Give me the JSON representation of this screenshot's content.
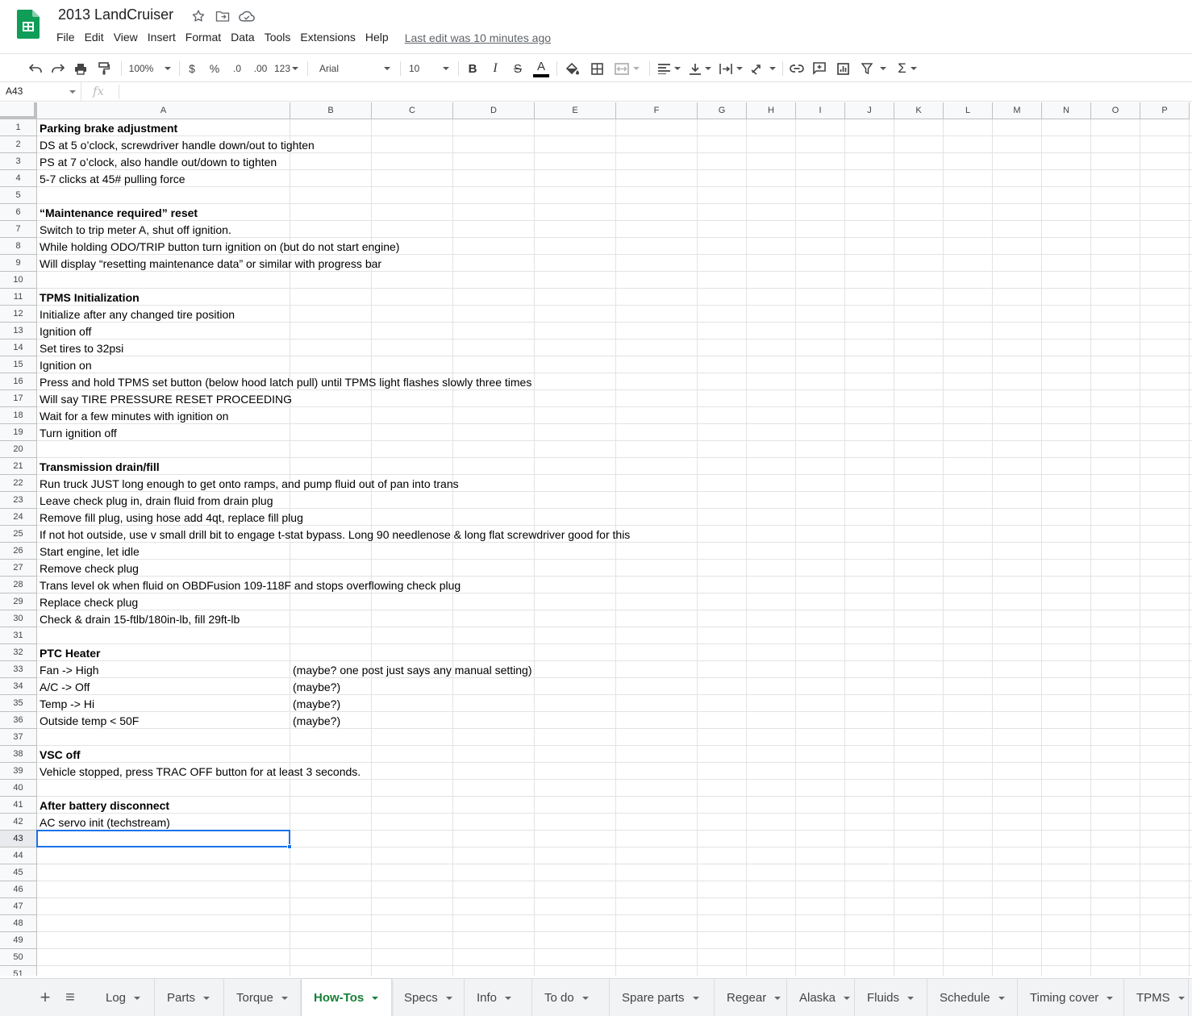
{
  "app": {
    "doc_title": "2013 LandCruiser",
    "last_edit": "Last edit was 10 minutes ago",
    "brand_color": "#0f9d58"
  },
  "menu": [
    "File",
    "Edit",
    "View",
    "Insert",
    "Format",
    "Data",
    "Tools",
    "Extensions",
    "Help"
  ],
  "toolbar": {
    "zoom": "100%",
    "currency": "$",
    "percent": "%",
    "decrease_decimal": ".0",
    "increase_decimal": ".00",
    "number_format": "123",
    "font": "Arial",
    "font_size": "10",
    "text_color": "#000000"
  },
  "formula_bar": {
    "cell_ref": "A43",
    "fx": "fx",
    "value": ""
  },
  "columns": [
    "A",
    "B",
    "C",
    "D",
    "E",
    "F",
    "G",
    "H",
    "I",
    "J",
    "K",
    "L",
    "M",
    "N",
    "O",
    "P"
  ],
  "rows": [
    "1",
    "2",
    "3",
    "4",
    "5",
    "6",
    "7",
    "8",
    "9",
    "10",
    "11",
    "12",
    "13",
    "14",
    "15",
    "16",
    "17",
    "18",
    "19",
    "20",
    "21",
    "22",
    "23",
    "24",
    "25",
    "26",
    "27",
    "28",
    "29",
    "30",
    "31",
    "32",
    "33",
    "34",
    "35",
    "36",
    "37",
    "38",
    "39",
    "40",
    "41",
    "42",
    "43",
    "44",
    "45",
    "46",
    "47",
    "48",
    "49",
    "50",
    "51"
  ],
  "cells": [
    {
      "row": 1,
      "col": "A",
      "text": "Parking brake adjustment",
      "bold": true
    },
    {
      "row": 2,
      "col": "A",
      "text": "DS at 5 o’clock, screwdriver handle down/out to tighten"
    },
    {
      "row": 3,
      "col": "A",
      "text": "PS at 7 o’clock, also handle out/down to tighten"
    },
    {
      "row": 4,
      "col": "A",
      "text": "5-7 clicks at 45# pulling force"
    },
    {
      "row": 6,
      "col": "A",
      "text": "“Maintenance required” reset",
      "bold": true
    },
    {
      "row": 7,
      "col": "A",
      "text": "Switch to trip meter A, shut off ignition."
    },
    {
      "row": 8,
      "col": "A",
      "text": "While holding ODO/TRIP button turn ignition on (but do not start engine)"
    },
    {
      "row": 9,
      "col": "A",
      "text": "Will display “resetting maintenance data” or similar with progress bar"
    },
    {
      "row": 11,
      "col": "A",
      "text": "TPMS Initialization",
      "bold": true
    },
    {
      "row": 12,
      "col": "A",
      "text": "Initialize after any changed tire position"
    },
    {
      "row": 13,
      "col": "A",
      "text": "Ignition off"
    },
    {
      "row": 14,
      "col": "A",
      "text": "Set tires to 32psi"
    },
    {
      "row": 15,
      "col": "A",
      "text": "Ignition on"
    },
    {
      "row": 16,
      "col": "A",
      "text": "Press and hold TPMS set button (below hood latch pull) until TPMS light flashes slowly three times"
    },
    {
      "row": 17,
      "col": "A",
      "text": "Will say TIRE PRESSURE RESET PROCEEDING"
    },
    {
      "row": 18,
      "col": "A",
      "text": "Wait for a few minutes with ignition on"
    },
    {
      "row": 19,
      "col": "A",
      "text": "Turn ignition off"
    },
    {
      "row": 21,
      "col": "A",
      "text": "Transmission drain/fill",
      "bold": true
    },
    {
      "row": 22,
      "col": "A",
      "text": "Run truck JUST long enough to get onto ramps, and pump fluid out of pan into trans"
    },
    {
      "row": 23,
      "col": "A",
      "text": "Leave check plug in, drain fluid from drain plug"
    },
    {
      "row": 24,
      "col": "A",
      "text": "Remove fill plug, using hose add 4qt, replace fill plug"
    },
    {
      "row": 25,
      "col": "A",
      "text": "If not hot outside, use v small drill bit to engage t-stat bypass. Long 90 needlenose & long flat screwdriver good for this"
    },
    {
      "row": 26,
      "col": "A",
      "text": "Start engine, let idle"
    },
    {
      "row": 27,
      "col": "A",
      "text": "Remove check plug"
    },
    {
      "row": 28,
      "col": "A",
      "text": "Trans level ok when fluid on OBDFusion 109-118F and stops overflowing check plug"
    },
    {
      "row": 29,
      "col": "A",
      "text": "Replace check plug"
    },
    {
      "row": 30,
      "col": "A",
      "text": "Check & drain 15-ftlb/180in-lb, fill 29ft-lb"
    },
    {
      "row": 32,
      "col": "A",
      "text": "PTC Heater",
      "bold": true
    },
    {
      "row": 33,
      "col": "A",
      "text": "Fan -> High"
    },
    {
      "row": 33,
      "col": "B",
      "text": "(maybe? one post just says any manual setting)"
    },
    {
      "row": 34,
      "col": "A",
      "text": "A/C -> Off"
    },
    {
      "row": 34,
      "col": "B",
      "text": "(maybe?)"
    },
    {
      "row": 35,
      "col": "A",
      "text": "Temp -> Hi"
    },
    {
      "row": 35,
      "col": "B",
      "text": "(maybe?)"
    },
    {
      "row": 36,
      "col": "A",
      "text": "Outside temp < 50F"
    },
    {
      "row": 36,
      "col": "B",
      "text": "(maybe?)"
    },
    {
      "row": 38,
      "col": "A",
      "text": "VSC off",
      "bold": true
    },
    {
      "row": 39,
      "col": "A",
      "text": "Vehicle stopped, press TRAC OFF button for at least 3 seconds."
    },
    {
      "row": 41,
      "col": "A",
      "text": "After battery disconnect",
      "bold": true
    },
    {
      "row": 42,
      "col": "A",
      "text": "AC servo init (techstream)"
    }
  ],
  "selected_cell": {
    "row": 43,
    "col": "A",
    "color": "#1a73e8"
  },
  "sheet_tabs": [
    {
      "label": "Log",
      "active": false
    },
    {
      "label": "Parts",
      "active": false
    },
    {
      "label": "Torque",
      "active": false
    },
    {
      "label": "How-Tos",
      "active": true
    },
    {
      "label": "Specs",
      "active": false
    },
    {
      "label": "Info",
      "active": false
    },
    {
      "label": "To do",
      "active": false
    },
    {
      "label": "Spare parts",
      "active": false
    },
    {
      "label": "Regear",
      "active": false
    },
    {
      "label": "Alaska",
      "active": false
    },
    {
      "label": "Fluids",
      "active": false
    },
    {
      "label": "Schedule",
      "active": false
    },
    {
      "label": "Timing cover",
      "active": false
    },
    {
      "label": "TPMS",
      "active": false
    }
  ],
  "tab_controls": {
    "add": "+",
    "all_sheets": "≡"
  },
  "active_tab_color": "#188038"
}
